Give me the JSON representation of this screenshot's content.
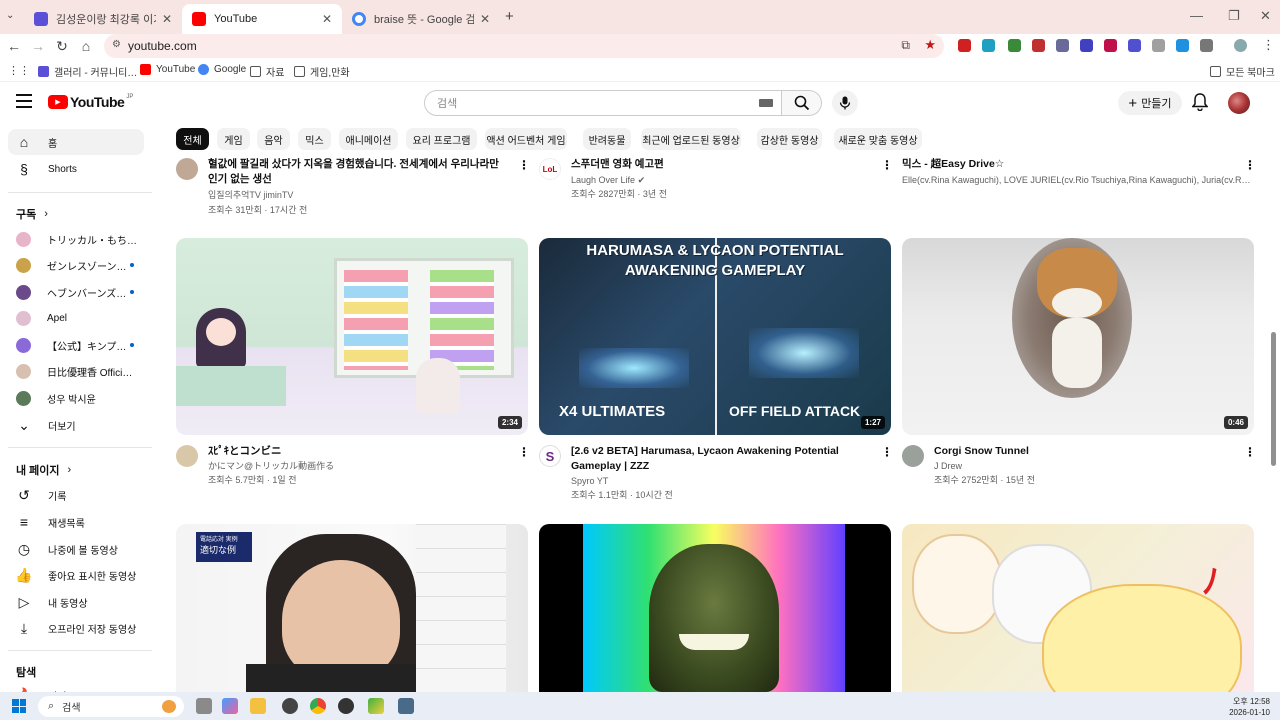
{
  "browser": {
    "tabs": [
      {
        "label": "김성운이랑 최강록 이거 뭐냐…",
        "color": "#5b4fd8"
      },
      {
        "label": "YouTube",
        "color": "#ff0000"
      },
      {
        "label": "braise 뜻 - Google 검색",
        "color": "#4285f4"
      }
    ],
    "new_tab": "+",
    "url": "youtube.com",
    "bookmarks": [
      "갤러리 - 커뮤니티…",
      "YouTube",
      "Google",
      "자료",
      "게임,만화"
    ],
    "all_bookmarks": "모든 북마크"
  },
  "youtube": {
    "logo_text": "YouTube",
    "logo_region": "JP",
    "search_placeholder": "검색",
    "create_label": "만들기",
    "chips": [
      "전체",
      "게임",
      "음악",
      "믹스",
      "애니메이션",
      "요리 프로그램",
      "액션 어드벤처 게임",
      "반려동물",
      "최근에 업로드된 동영상",
      "감상한 동영상",
      "새로운 맞춤 동영상"
    ],
    "sidebar": {
      "home": "홈",
      "shorts": "Shorts",
      "subscriptions_header": "구독",
      "subscriptions": [
        {
          "label": "トリッカル・もち…",
          "dot": false,
          "color": "#e8b4c8"
        },
        {
          "label": "ゼンレスゾーン…",
          "dot": true,
          "color": "#c9a24a"
        },
        {
          "label": "ヘブンバーンズ…",
          "dot": true,
          "color": "#6a4a8a"
        },
        {
          "label": "Apel",
          "dot": false,
          "color": "#e0c0d0"
        },
        {
          "label": "【公式】キンプ…",
          "dot": true,
          "color": "#8a6ad8"
        },
        {
          "label": "日比優理香 Official …",
          "dot": false,
          "color": "#d8c0b0"
        },
        {
          "label": "성우 박시윤",
          "dot": false,
          "color": "#5a7a5a"
        }
      ],
      "more": "더보기",
      "you_header": "내 페이지",
      "you_items": [
        "기록",
        "재생목록",
        "나중에 볼 동영상",
        "좋아요 표시한 동영상",
        "내 동영상",
        "오프라인 저장 동영상"
      ],
      "explore_header": "탐색",
      "explore_partial": "인기"
    },
    "row0": [
      {
        "title": "혈값에 팔길래 샀다가 지옥을 경험했습니다. 전세계에서 우리나라만 인기 없는 생선",
        "channel": "입질의추억TV jiminTV",
        "meta": "조회수 31만회 · 17시간 전"
      },
      {
        "title": "스푸더맨 영화 예고편",
        "channel": "Laugh Over Life",
        "meta": "조회수 2827만회 · 3년 전"
      },
      {
        "title": "믹스 - 超Easy Drive☆",
        "channel": "Elle(cv.Rina Kawaguchi), LOVE JURIEL(cv.Rio Tsuchiya,Rina Kawaguchi), Juria(cv.Ri…",
        "meta": ""
      }
    ],
    "row1": [
      {
        "title": "ｽﾋﾟｷとコンビニ",
        "channel": "かにマン@トリッカル動画作る",
        "meta": "조회수 5.7만회 · 1일 전",
        "duration": "2:34"
      },
      {
        "title": "[2.6 v2 BETA] Harumasa, Lycaon Awakening Potential Gameplay | ZZZ",
        "channel": "Spyro YT",
        "meta": "조회수 1.1만회 · 10시간 전",
        "duration": "1:27",
        "thumb_top": "HARUMASA & LYCAON POTENTIAL",
        "thumb_top2": "AWAKENING GAMEPLAY",
        "thumb_left": "X4 ULTIMATES",
        "thumb_right": "OFF FIELD ATTACK"
      },
      {
        "title": "Corgi Snow Tunnel",
        "channel": "J Drew",
        "meta": "조회수 2752만회 · 15년 전",
        "duration": "0:46"
      }
    ],
    "row2_thumb_caption": "適切な例",
    "row2_thumb_caption_top": "電話応対 実例"
  },
  "taskbar": {
    "search_placeholder": "검색",
    "time": "오후 12:58",
    "date": "2026-01-10"
  }
}
